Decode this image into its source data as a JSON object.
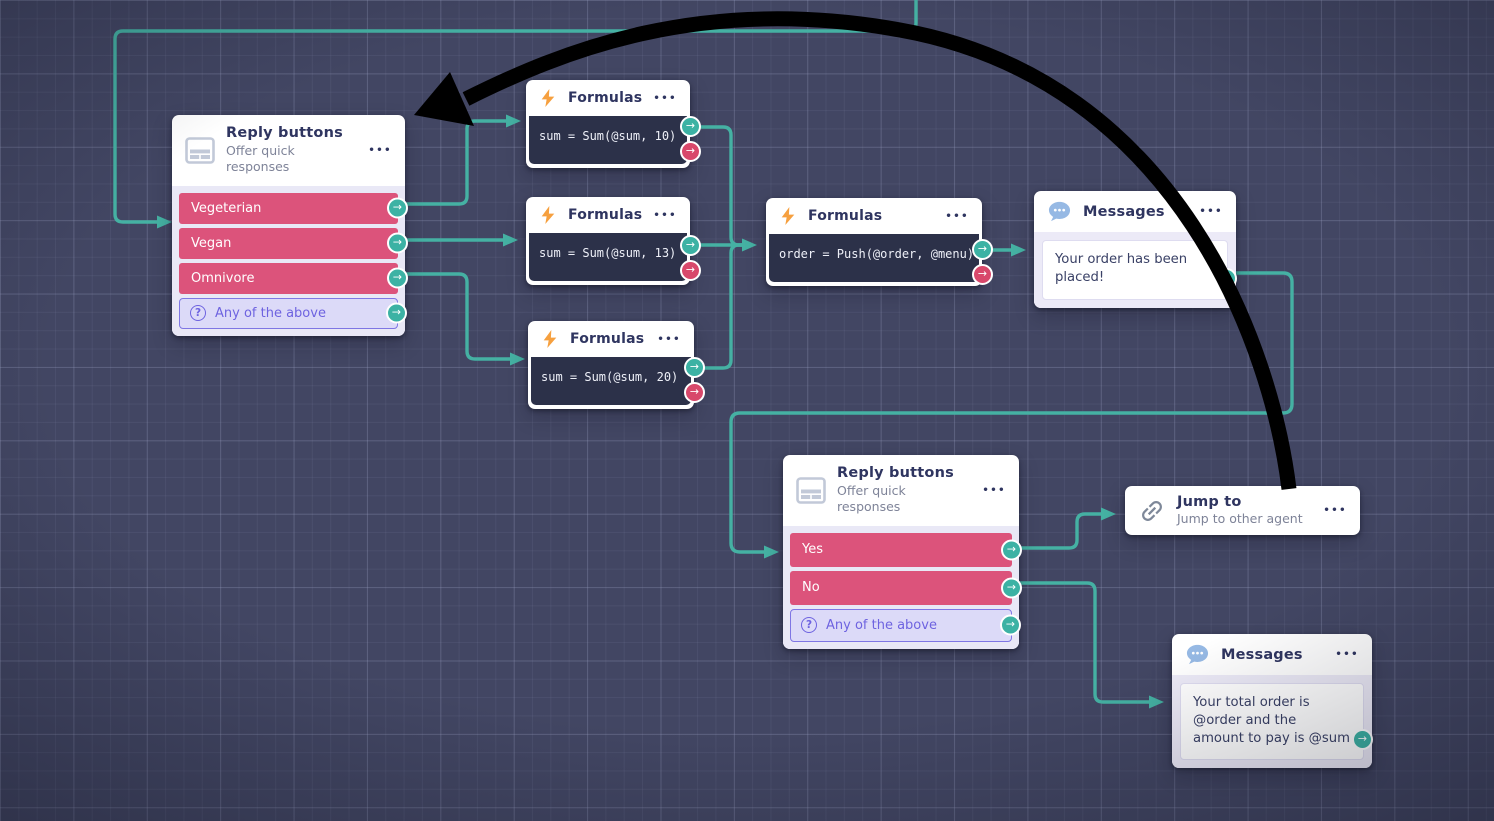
{
  "icons": {
    "more": "•••",
    "port_arrow": "→",
    "question": "?"
  },
  "colors": {
    "canvas": "#424663",
    "connector_teal": "#45b1a3",
    "option_pink": "#dc537b",
    "error_port_red": "#d8486b",
    "formula_body_navy": "#2c3149",
    "fallback_purple": "#6e63e0",
    "annotation_black": "#000000",
    "bolt_orange": "#f6a03f",
    "bubble_blue": "#96b9e4"
  },
  "nodes": {
    "reply1": {
      "title": "Reply buttons",
      "subtitle": "Offer quick responses",
      "options": [
        {
          "label": "Vegeterian"
        },
        {
          "label": "Vegan"
        },
        {
          "label": "Omnivore"
        }
      ],
      "fallback": {
        "label": "Any of the above"
      }
    },
    "formulas1": {
      "title": "Formulas",
      "code": "sum = Sum(@sum, 10)"
    },
    "formulas2": {
      "title": "Formulas",
      "code": "sum = Sum(@sum, 13)"
    },
    "formulas3": {
      "title": "Formulas",
      "code": "sum = Sum(@sum, 20)"
    },
    "formulas4": {
      "title": "Formulas",
      "code": "order = Push(@order, @menu)"
    },
    "messages1": {
      "title": "Messages",
      "text": "Your order has been placed!"
    },
    "reply2": {
      "title": "Reply buttons",
      "subtitle": "Offer quick responses",
      "options": [
        {
          "label": "Yes"
        },
        {
          "label": "No"
        }
      ],
      "fallback": {
        "label": "Any of the above"
      }
    },
    "jump": {
      "title": "Jump to",
      "subtitle": "Jump to other agent"
    },
    "messages2": {
      "title": "Messages",
      "text": "Your total order is @order and the amount to pay is @sum"
    }
  }
}
